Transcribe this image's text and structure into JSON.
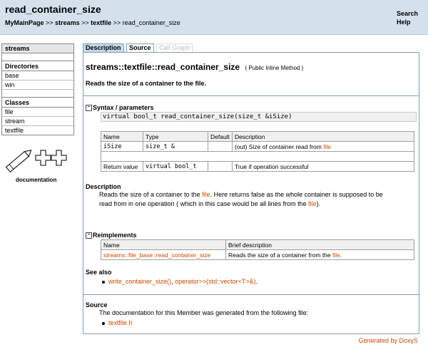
{
  "header": {
    "title": "read_container_size",
    "breadcrumb": [
      "MyMainPage",
      "streams",
      "textfile",
      "read_container_size"
    ],
    "sep": ">>",
    "search": "Search",
    "help": "Help"
  },
  "sidebar": {
    "top": "streams",
    "dirs_heading": "Directories",
    "dirs": [
      "base",
      "win"
    ],
    "classes_heading": "Classes",
    "classes": [
      "file",
      "stream",
      "textfile"
    ]
  },
  "logo": {
    "text": "documentation"
  },
  "tabs": {
    "description": "Description",
    "source": "Source",
    "callgraph": "Call Graph"
  },
  "main": {
    "title": "streams::textfile::read_container_size",
    "title_suffix": "( Public Inline Method )",
    "short_desc": "Reads the size of a container to the file.",
    "syntax_heading": "Syntax / parameters",
    "signature": "virtual bool_t read_container_size(size_t &iSize)",
    "param_headers": [
      "Name",
      "Type",
      "Default",
      "Description"
    ],
    "param": {
      "name": "iSize",
      "type": "size_t &",
      "default": "",
      "desc": "(out) Size of container read from ",
      "desc_link": "file"
    },
    "ret": {
      "name": "Return value",
      "type": "virtual bool_t",
      "default": "",
      "desc": "True if operation successful"
    },
    "description_heading": "Description",
    "description_1": "Reads the size of a container to the ",
    "description_link1": "file",
    "description_2": ". Here returns false as the whole container is supposed to be",
    "description_3": "read from in one operation ( which in this case would be all lines from the ",
    "description_link2": "file",
    "description_4": ").",
    "reimpl_heading": "Reimplements",
    "reimpl_headers": [
      "Name",
      "Brief description"
    ],
    "reimpl": {
      "name": "streams::file_base::read_container_size",
      "brief": "Reads the size of a container from the ",
      "brief_link": "file",
      "brief_end": "."
    },
    "seealso_heading": "See also",
    "seealso_1": "write_container_size()",
    "seealso_sep": ", ",
    "seealso_2": "operator>>(std::vector<T>&)",
    "seealso_end": ".",
    "source_heading": "Source",
    "source_text": "The documentation for this Member was generated from the following file:",
    "source_file": "textfile.h"
  },
  "footer": "Generated by DoxyS"
}
